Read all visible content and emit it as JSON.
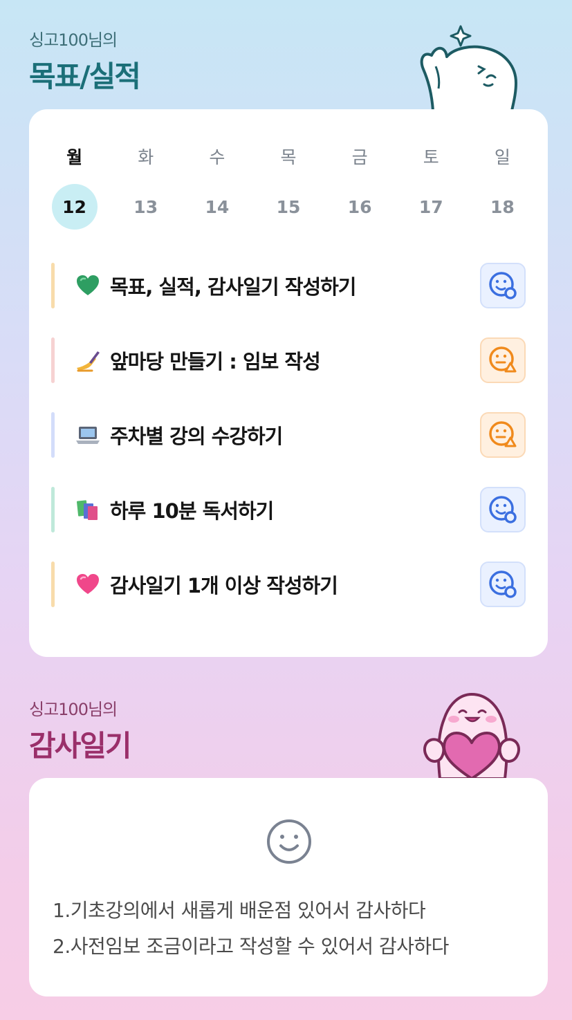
{
  "goal_section": {
    "subtitle": "싱고100님의",
    "title": "목표/실적"
  },
  "week": {
    "days": [
      "월",
      "화",
      "수",
      "목",
      "금",
      "토",
      "일"
    ],
    "dates": [
      "12",
      "13",
      "14",
      "15",
      "16",
      "17",
      "18"
    ],
    "selected_index": 0
  },
  "tasks": [
    {
      "emoji": "green-heart",
      "label": "목표, 실적, 감사일기 작성하기",
      "status": "good",
      "bar_color": "#f8dcab"
    },
    {
      "emoji": "writing-hand",
      "label": "앞마당 만들기 : 임보 작성",
      "status": "warning",
      "bar_color": "#f6d2d2"
    },
    {
      "emoji": "laptop",
      "label": "주차별 강의 수강하기",
      "status": "warning",
      "bar_color": "#d3ddfa"
    },
    {
      "emoji": "books",
      "label": "하루 10분 독서하기",
      "status": "good",
      "bar_color": "#bfe9da"
    },
    {
      "emoji": "pink-heart",
      "label": "감사일기 1개 이상 작성하기",
      "status": "good",
      "bar_color": "#f8dcab"
    }
  ],
  "thanks_section": {
    "subtitle": "싱고100님의",
    "title": "감사일기"
  },
  "thanks_entries": [
    "1.기초강의에서 새롭게 배운점 있어서 감사하다",
    "2.사전임보 조금이라고 작성할 수 있어서 감사하다"
  ],
  "icons": {
    "status_good": "smile-check-icon",
    "status_warning": "smile-warning-icon",
    "thanks_face": "smile-face-icon"
  },
  "colors": {
    "good_icon": "#3b6fe0",
    "warning_icon": "#f08a1c",
    "selected_date_bg": "#c9eef4",
    "goal_title": "#1b6f78",
    "thanks_title": "#9a2f6a"
  }
}
